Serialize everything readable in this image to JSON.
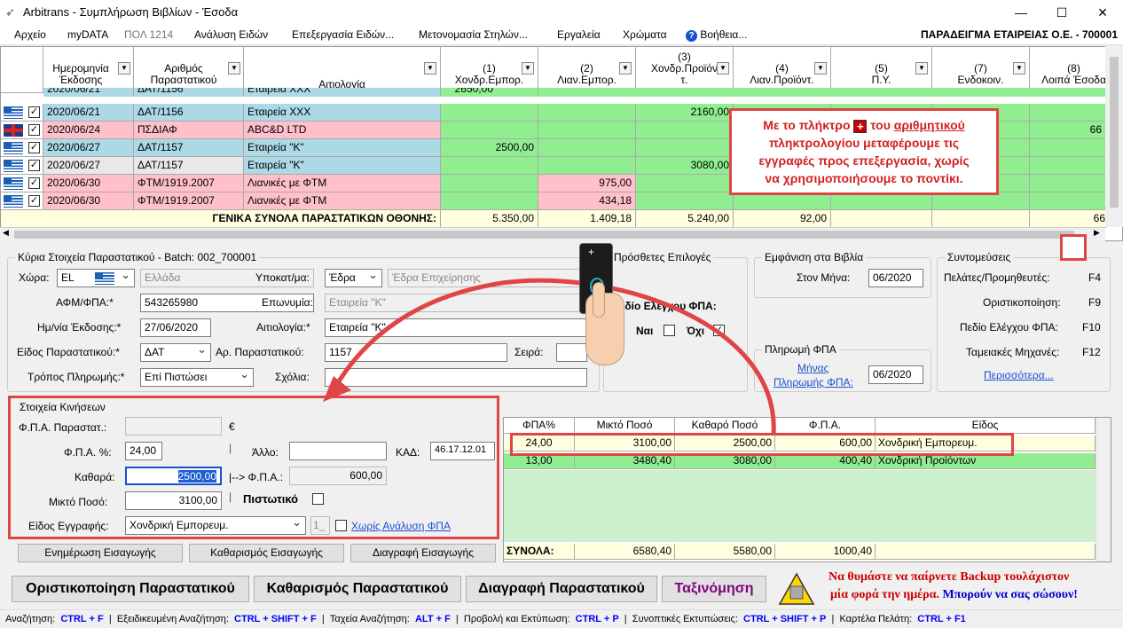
{
  "window": {
    "title": "Arbitrans - Συμπλήρωση Βιβλίων - Έσοδα",
    "company": "ΠΑΡΑΔΕΙΓΜΑ ΕΤΑΙΡΕΙΑΣ Ο.Ε. - 700001"
  },
  "menu": [
    "Αρχείο",
    "myDATA",
    "ΠΟΛ 1214",
    "Ανάλυση Ειδών",
    "Επεξεργασία Ειδών...",
    "Μετονομασία Στηλών...",
    "Εργαλεία",
    "Χρώματα",
    "Βοήθεια..."
  ],
  "grid": {
    "headers": {
      "date": "Ημερομηνία Έκδοσης",
      "doc": "Αριθμός Παραστατικού",
      "reason": "Αιτιολογία",
      "c1": [
        "(1)",
        "Χονδρ.Εμπορ."
      ],
      "c2": [
        "(2)",
        "Λιαν.Εμπορ."
      ],
      "c3": [
        "(3)",
        "Χονδρ.Προϊόν",
        "τ."
      ],
      "c4": [
        "(4)",
        "Λιαν.Προϊόντ."
      ],
      "c5": [
        "(5)",
        "Π.Υ."
      ],
      "c7": [
        "(7)",
        "Ενδοκοιν."
      ],
      "c8": [
        "(8)",
        "Λοιπά Έσοδα"
      ]
    },
    "partial_row": {
      "date": "2020/06/21",
      "doc": "ΔΑΤ/1156",
      "reason": "Εταιρεία ΧΧΧ",
      "c1": "2650,00"
    },
    "rows": [
      {
        "flag": "gr",
        "checked": "✓",
        "date": "2020/06/21",
        "doc": "ΔΑΤ/1156",
        "reason": "Εταιρεία ΧΧΧ",
        "c1": "",
        "c2": "",
        "c3": "2160,00",
        "c4": "",
        "c8": "",
        "color": "blue"
      },
      {
        "flag": "uk",
        "checked": "✓",
        "date": "2020/06/24",
        "doc": "ΠΣΔΙΑΦ",
        "reason": "ABC&D LTD",
        "c1": "",
        "c2": "",
        "c3": "",
        "c4": "",
        "c8": "66",
        "color": "pink"
      },
      {
        "flag": "gr",
        "checked": "✓",
        "date": "2020/06/27",
        "doc": "ΔΑΤ/1157",
        "reason": "Εταιρεία \"Κ\"",
        "c1": "2500,00",
        "c2": "",
        "c3": "",
        "c4": "",
        "c8": "",
        "color": "blue"
      },
      {
        "flag": "gr",
        "checked": "✓",
        "date": "2020/06/27",
        "doc": "ΔΑΤ/1157",
        "reason": "Εταιρεία \"Κ\"",
        "c1": "",
        "c2": "",
        "c3": "3080,00",
        "c4": "",
        "c8": "",
        "color": "blue"
      },
      {
        "flag": "gr",
        "checked": "✓",
        "date": "2020/06/30",
        "doc": "ΦΤΜ/1919.2007",
        "reason": "Λιανικές με ΦΤΜ",
        "c1": "",
        "c2": "975,00",
        "c3": "",
        "c4": "",
        "c8": "",
        "color": "pink"
      },
      {
        "flag": "gr",
        "checked": "✓",
        "date": "2020/06/30",
        "doc": "ΦΤΜ/1919.2007",
        "reason": "Λιανικές με ΦΤΜ",
        "c1": "",
        "c2": "434,18",
        "c3": "",
        "c4": "",
        "c8": "",
        "color": "pink"
      }
    ],
    "totals": {
      "label": "ΓΕΝΙΚΑ ΣΥΝΟΛΑ ΠΑΡΑΣΤΑΤΙΚΩΝ ΟΘΟΝΗΣ:",
      "c1": "5.350,00",
      "c2": "1.409,18",
      "c3": "5.240,00",
      "c4": "92,00",
      "c8": "66"
    }
  },
  "callout": {
    "line1_pre": "Με το πλήκτρο",
    "key": "+",
    "line1_post": "του",
    "line1_link": "αριθμητικού",
    "line2": "πληκτρολογίου μεταφέρουμε τις",
    "line3": "εγγραφές προς επεξεργασία, χωρίς",
    "line4": "να χρησιμοποιήσουμε το ποντίκι."
  },
  "main_group": {
    "legend": "Κύρια Στοιχεία Παραστατικού - Batch: 002_700001",
    "country_label": "Χώρα:",
    "country_code": "EL",
    "country_name": "Ελλάδα",
    "branch_label": "Υποκατ/μα:",
    "branch_value": "Έδρα",
    "branch_name": "Έδρα Επιχείρησης",
    "vat_label": "ΑΦΜ/ΦΠΑ:*",
    "vat_value": "543265980",
    "name_label": "Επωνυμία:",
    "name_value": "Εταιρεία \"Κ\"",
    "date_label": "Ημ/νία Έκδοσης:*",
    "date_value": "27/06/2020",
    "reason_label": "Αιτιολογία:*",
    "reason_value": "Εταιρεία \"Κ\"",
    "doctype_label": "Είδος Παραστατικού:*",
    "doctype_value": "ΔΑΤ",
    "docnum_label": "Αρ. Παραστατικού:",
    "docnum_value": "1157",
    "series_label": "Σειρά:",
    "series_value": "",
    "payment_label": "Τρόπος Πληρωμής:*",
    "payment_value": "Επί Πιστώσει",
    "comments_label": "Σχόλια:",
    "comments_value": ""
  },
  "extra_group": {
    "legend": "Πρόσθετες Επιλογές",
    "vat_check_label": "Πεδίο Ελέγχου ΦΠΑ:",
    "yes_label": "Ναι",
    "yes_checked": "",
    "no_label": "Όχι",
    "no_checked": "✓"
  },
  "books_group": {
    "legend": "Εμφάνιση στα Βιβλία",
    "month_label": "Στον Μήνα:",
    "month_value": "06/2020"
  },
  "payvat_group": {
    "legend": "Πληρωμή ΦΠΑ",
    "link": "Μήνας Πληρωμής ΦΠΑ:",
    "link_line1": "Μήνας",
    "link_line2": "Πληρωμής ΦΠΑ:",
    "value": "06/2020"
  },
  "shortcuts_group": {
    "legend": "Συντομεύσεις",
    "items": [
      {
        "label": "Πελάτες/Προμηθευτές:",
        "key": "F4"
      },
      {
        "label": "Οριστικοποίηση:",
        "key": "F9"
      },
      {
        "label": "Πεδίο Ελέγχου ΦΠΑ:",
        "key": "F10"
      },
      {
        "label": "Ταμειακές Μηχανές:",
        "key": "F12"
      }
    ],
    "more": "Περισσότερα..."
  },
  "movement_group": {
    "legend": "Στοιχεία Κινήσεων",
    "vatdoc_label": "Φ.Π.Α. Παραστατ.:",
    "vatdoc_value": "",
    "euro": "€",
    "vatpct_label": "Φ.Π.Α. %:",
    "vatpct_value": "24,00",
    "other_label": "Άλλο:",
    "other_value": "",
    "kad_label": "ΚΑΔ:",
    "kad_value": "46.17.12.01",
    "net_label": "Καθαρά:",
    "net_value": "2500,00",
    "arrow_label": "|--> Φ.Π.Α.:",
    "vat_value": "600,00",
    "gross_label": "Μικτό Ποσό:",
    "gross_value": "3100,00",
    "credit_label": "Πιστωτικό",
    "entry_label": "Είδος Εγγραφής:",
    "entry_value": "Χονδρική Εμπορευμ.",
    "entry_code": "1_",
    "no_analysis": "Χωρίς Ανάλυση ΦΠΑ"
  },
  "movement_buttons": [
    "Ενημέρωση Εισαγωγής",
    "Καθαρισμός Εισαγωγής",
    "Διαγραφή Εισαγωγής"
  ],
  "vat_grid": {
    "headers": [
      "ΦΠΑ%",
      "Μικτό Ποσό",
      "Καθαρό Ποσό",
      "Φ.Π.Α.",
      "Είδος"
    ],
    "rows": [
      [
        "24,00",
        "3100,00",
        "2500,00",
        "600,00",
        "Χονδρική Εμπορευμ."
      ],
      [
        "13,00",
        "3480,40",
        "3080,00",
        "400,40",
        "Χονδρική Προϊόντων"
      ]
    ],
    "totals_label": "ΣΥΝΟΛΑ:",
    "totals": [
      "6580,40",
      "5580,00",
      "1000,40"
    ]
  },
  "bottom_buttons": [
    "Οριστικοποίηση Παραστατικού",
    "Καθαρισμός Παραστατικού",
    "Διαγραφή Παραστατικού",
    "Ταξινόμηση"
  ],
  "backup": {
    "line1": "Να θυμάστε να παίρνετε Backup τουλάχιστον",
    "line2a": "μία φορά την ημέρα.",
    "line2b": "Μπορούν να σας σώσουν!"
  },
  "status": [
    {
      "label": "Αναζήτηση:",
      "key": "CTRL + F"
    },
    {
      "label": "Εξειδικευμένη Αναζήτηση:",
      "key": "CTRL + SHIFT + F"
    },
    {
      "label": "Ταχεία Αναζήτηση:",
      "key": "ALT + F"
    },
    {
      "label": "Προβολή και Εκτύπωση:",
      "key": "CTRL + P"
    },
    {
      "label": "Συνοπτικές Εκτυπώσεις:",
      "key": "CTRL + SHIFT + P"
    },
    {
      "label": "Καρτέλα Πελάτη:",
      "key": "CTRL + F1"
    }
  ],
  "colors": {
    "blue_row": "#add8e6",
    "pink_row": "#ffc0cb",
    "green_cell": "#90ee90",
    "highlight": "#e04545"
  }
}
